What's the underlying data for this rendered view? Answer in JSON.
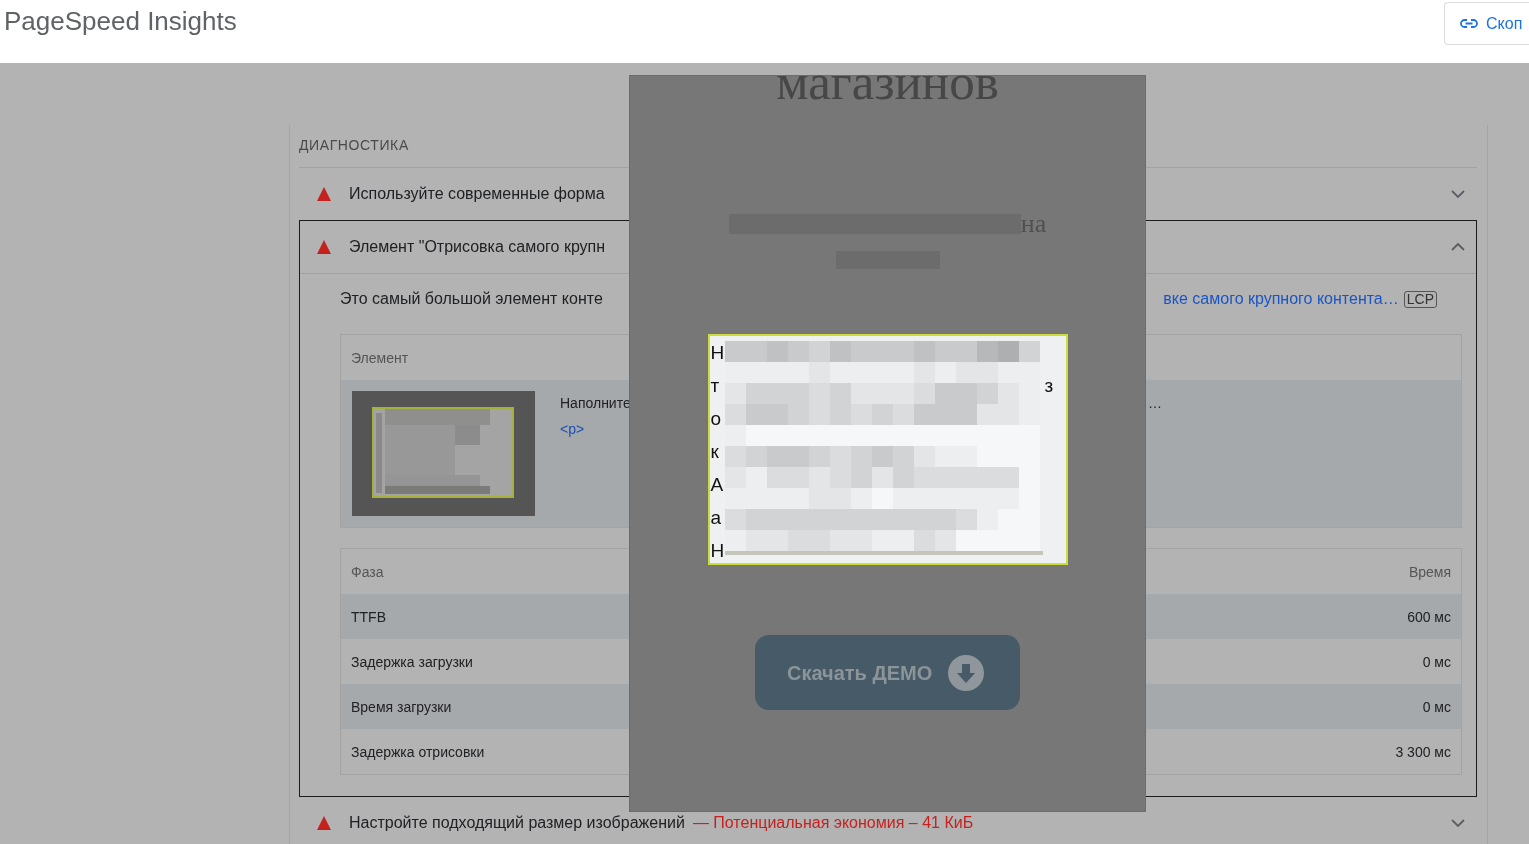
{
  "header": {
    "title": "PageSpeed Insights",
    "copy_button": {
      "label": "Скоп"
    }
  },
  "diagnostics": {
    "heading": "ДИАГНОСТИКА",
    "audits": [
      {
        "kind": "fail",
        "title": "Используйте современные форма",
        "expanded": false
      },
      {
        "kind": "fail",
        "title": "Элемент \"Отрисовка самого крупн",
        "expanded": true,
        "description": "Это самый большой элемент конте",
        "link": "вке самого крупного контента…",
        "badge": "LCP",
        "element_table": {
          "column": "Элемент",
          "rows": [
            {
              "snippet": "Наполните",
              "snippet_end": "…",
              "tag": "<p>"
            }
          ]
        },
        "phase_table": {
          "columns": [
            "Фаза",
            "Время"
          ],
          "rows": [
            {
              "phase": "TTFB",
              "time": "600 мс"
            },
            {
              "phase": "Задержка загрузки",
              "time": "0 мс"
            },
            {
              "phase": "Время загрузки",
              "time": "0 мс"
            },
            {
              "phase": "Задержка отрисовки",
              "time": "3 300 мс"
            }
          ]
        }
      },
      {
        "kind": "fail",
        "title": "Настройте подходящий размер изображений",
        "savings": "— Потенциальная экономия – 41 КиБ",
        "expanded": false
      }
    ]
  },
  "screenshot_preview": {
    "heading": "магазинов",
    "blurred_heading_end": "на",
    "highlight": {
      "line_starts": [
        "Н",
        "т",
        "о",
        "к",
        "А",
        "а",
        "Н"
      ],
      "line_end": "з"
    },
    "button": "Скачать ДЕМО"
  }
}
